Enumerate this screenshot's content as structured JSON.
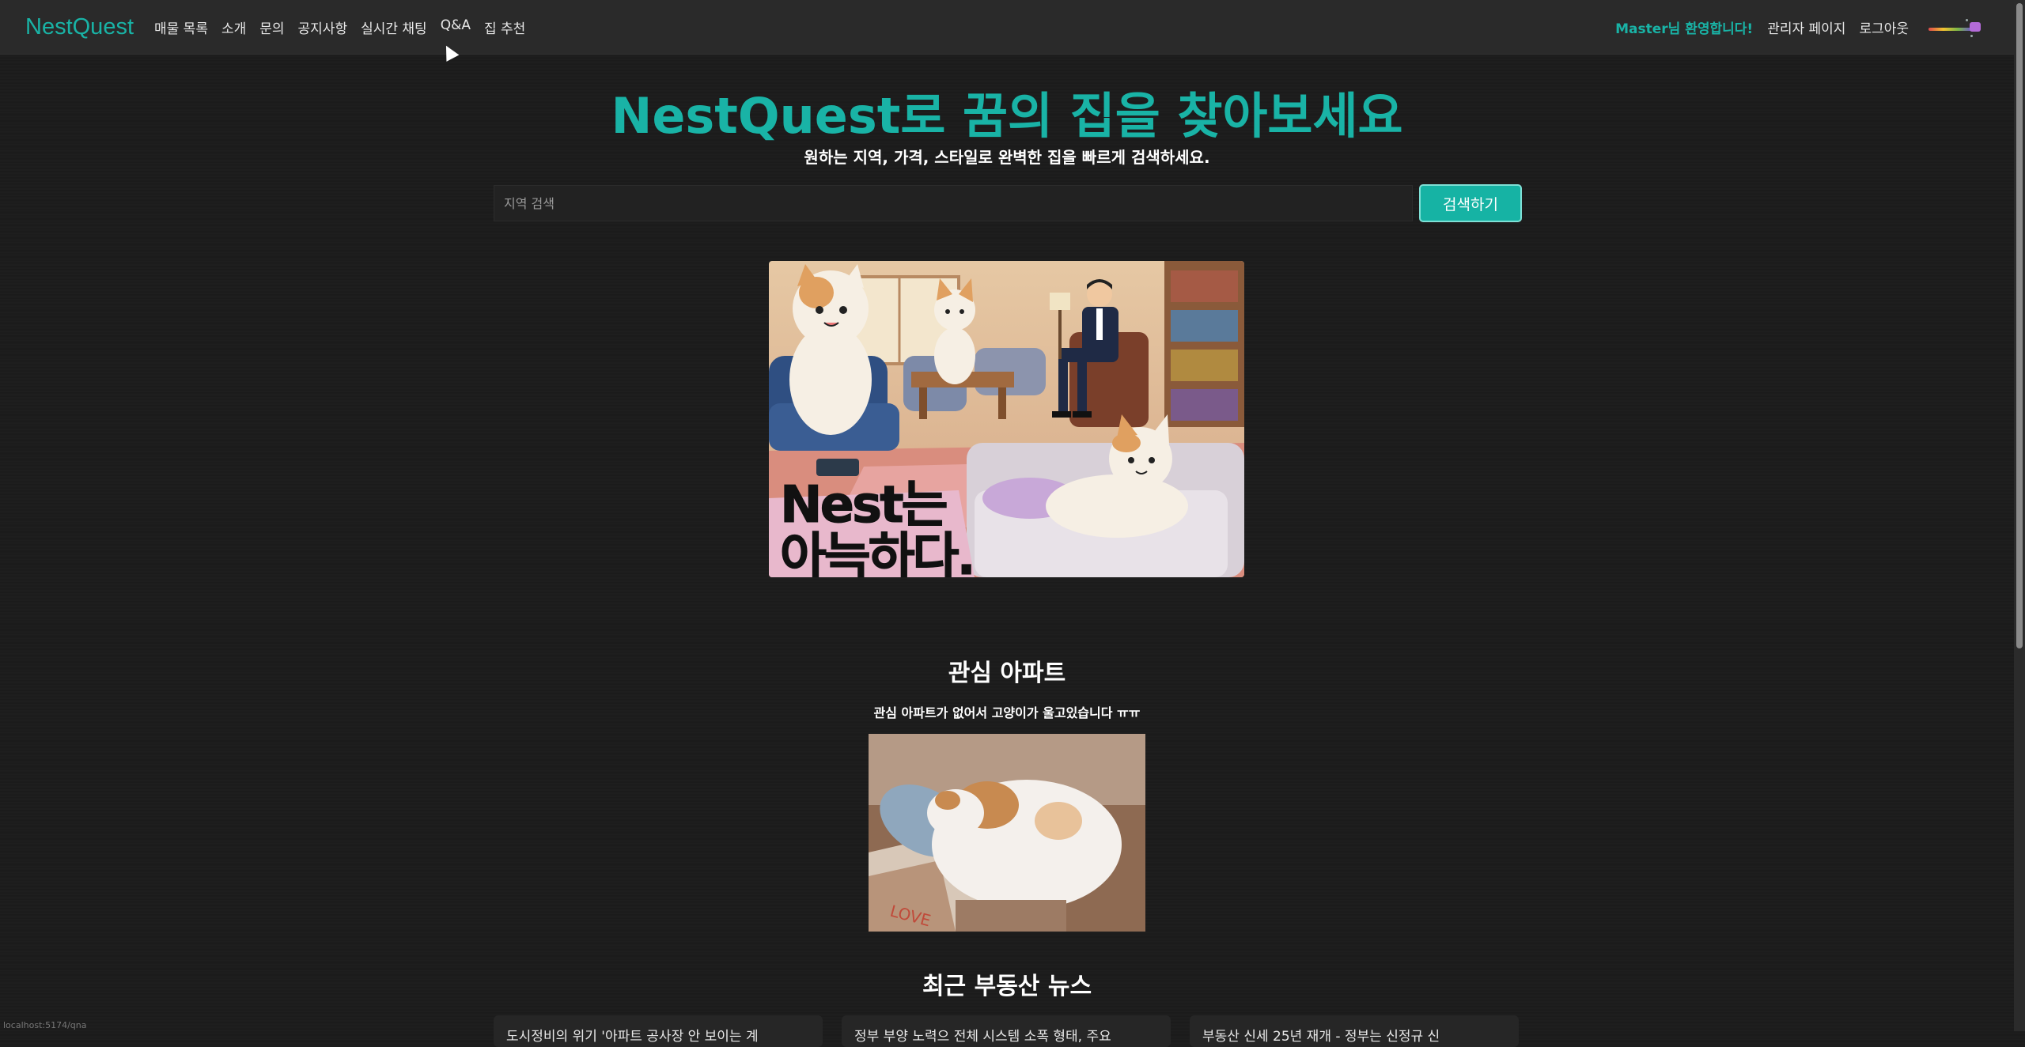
{
  "nav": {
    "brand": "NestQuest",
    "links": [
      "매물 목록",
      "소개",
      "문의",
      "공지사항",
      "실시간 채팅",
      "Q&A",
      "집 추천"
    ],
    "welcome": "Master님 환영합니다!",
    "admin": "관리자 페이지",
    "logout": "로그아웃",
    "theme_toggle_icon": "nyan-cat-icon"
  },
  "hero": {
    "title": "NestQuest로 꿈의 집을 찾아보세요",
    "subtitle": "원하는 지역, 가격, 스타일로 완벽한 집을 빠르게 검색하세요.",
    "search_placeholder": "지역 검색",
    "search_button": "검색하기"
  },
  "banner": {
    "text_line1": "Nest는",
    "text_line2": "아늑하다."
  },
  "interest": {
    "title": "관심 아파트",
    "empty_message": "관심 아파트가 없어서 고양이가 울고있습니다 ㅠㅠ"
  },
  "news": {
    "title": "최근 부동산 뉴스",
    "items": [
      "도시정비의 위기 '아파트 공사장 안 보이는 계",
      "정부 부양 노력으 전체 시스템 소폭 형태, 주요",
      "부동산 신세 25년 재개 - 정부는 신정규 신"
    ]
  },
  "status_url": "localhost:5174/qna",
  "colors": {
    "accent": "#19b3a6",
    "background": "#1b1b1b",
    "navbar": "#2a2a2a"
  }
}
